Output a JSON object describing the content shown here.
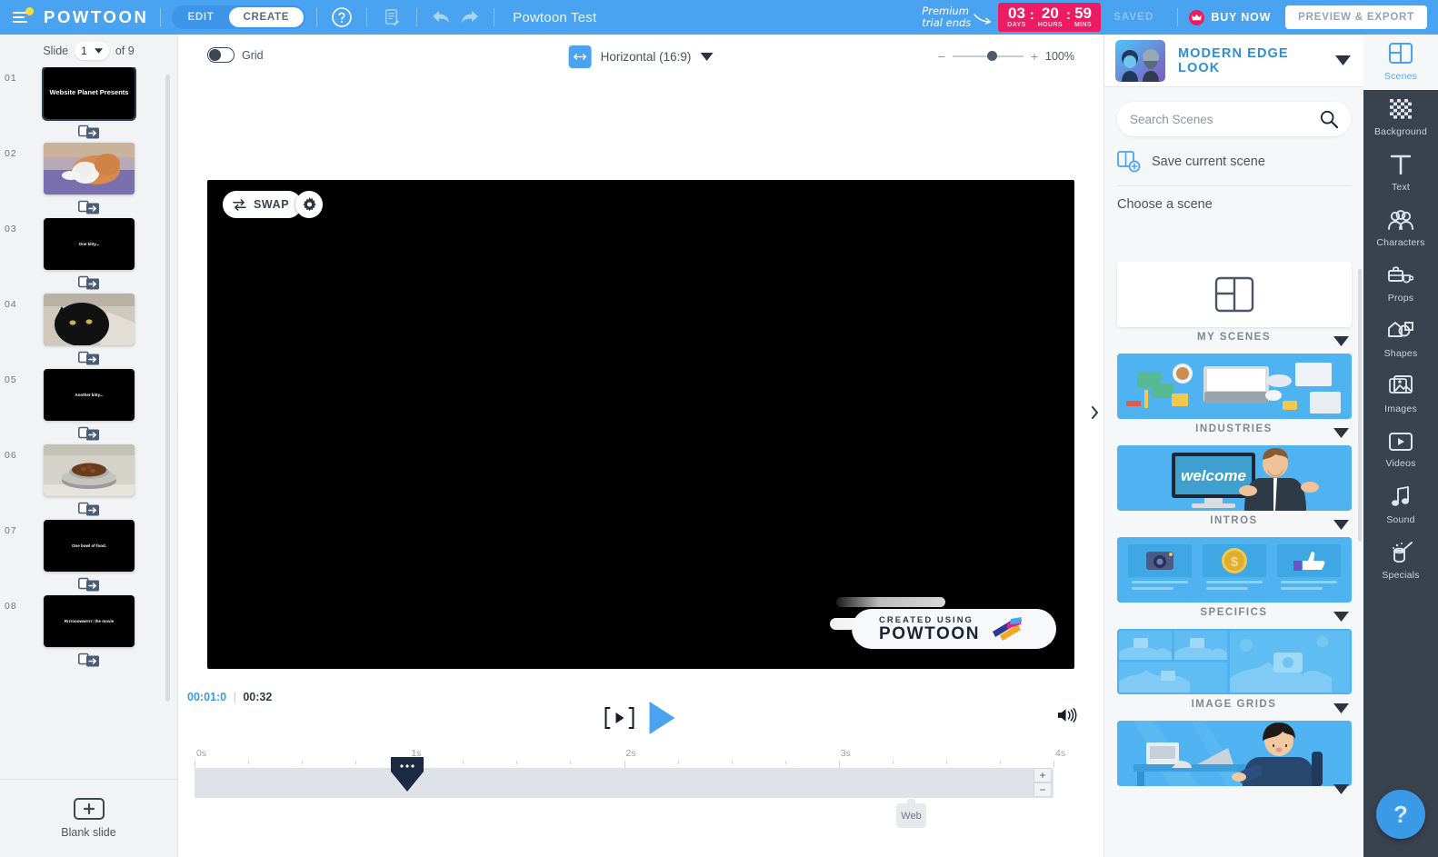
{
  "header": {
    "brand": "POWTOON",
    "modes": [
      {
        "label": "EDIT",
        "active": false
      },
      {
        "label": "CREATE",
        "active": true
      }
    ],
    "help_icon": "question-circle-icon",
    "notes_icon": "notes-edit-icon",
    "undo_icon": "undo-arrow-icon",
    "redo_icon": "redo-arrow-icon",
    "doc_title": "Powtoon Test",
    "promo_line1": "Premium",
    "promo_line2": "trial ends",
    "timer": {
      "days_value": "03",
      "days_label": "DAYS",
      "hours_value": "20",
      "hours_label": "HOURS",
      "mins_value": "59",
      "mins_label": "MINS",
      "separator": ":",
      "bg_color": "#ed1b61"
    },
    "saved_label": "SAVED",
    "buy_now_label": "BUY NOW",
    "crown_icon": "crown-icon",
    "preview_export_label": "PREVIEW & EXPORT",
    "bg_color": "#4aa3f0"
  },
  "slides": {
    "slide_word": "Slide",
    "current": "1",
    "of_label": "of 9",
    "total": 9,
    "items": [
      {
        "num": "01",
        "type": "text",
        "text": "Website Planet Presents",
        "font_size": "7.5px",
        "selected": true
      },
      {
        "num": "02",
        "type": "image",
        "subject": "orange-and-white-cat-in-cone-on-purple-blanket"
      },
      {
        "num": "03",
        "type": "text",
        "text": "One kitty...",
        "font_size": "4.5px",
        "selected": false
      },
      {
        "num": "04",
        "type": "image",
        "subject": "black-cat-on-tile-floor"
      },
      {
        "num": "05",
        "type": "text",
        "text": "Another kitty...",
        "font_size": "4.5px",
        "selected": false
      },
      {
        "num": "06",
        "type": "image",
        "subject": "metal-bowl-of-cat-food"
      },
      {
        "num": "07",
        "type": "text",
        "text": "One bowl of food.",
        "font_size": "4.5px",
        "selected": false
      },
      {
        "num": "08",
        "type": "text",
        "text": "Rrrrooowwrrrr: the movie",
        "font_size": "4.5px",
        "selected": false
      }
    ],
    "transition_icon": "slide-transition-icon",
    "blank_slide_label": "Blank slide",
    "add_icon": "plus-in-frame-icon",
    "collapse_icon": "chevron-left-icon"
  },
  "stage": {
    "grid_label": "Grid",
    "grid_on": false,
    "ratio_label": "Horizontal (16:9)",
    "ratio_icon": "horizontal-arrows-icon",
    "ratio_caret": "chevron-down-icon",
    "zoom_minus": "−",
    "zoom_plus": "+",
    "zoom_value": "100%",
    "swap_label": "SWAP",
    "swap_icon": "swap-arrows-icon",
    "settings_icon": "gear-icon",
    "watermark_small": "CREATED USING",
    "watermark_big": "POWTOON",
    "canvas_bg": "#000000",
    "collapse_icon": "chevron-right-icon"
  },
  "timeline": {
    "current_time": "00:01:0",
    "divider": "|",
    "total_time": "00:32",
    "step_icon": "step-frame-icon",
    "play_icon": "play-triangle-icon",
    "volume_icon": "speaker-waves-icon",
    "ruler_ticks": [
      "0s",
      "1s",
      "2s",
      "3s",
      "4s"
    ],
    "zoom_in_label": "+",
    "zoom_out_label": "−",
    "playhead_position_label": "1s",
    "web_tag": "Web"
  },
  "library": {
    "look_name": "MODERN EDGE LOOK",
    "look_caret": "chevron-down-icon",
    "search_placeholder": "Search Scenes",
    "search_value": "",
    "search_icon": "search-magnifier-icon",
    "save_scene_label": "Save current scene",
    "save_scene_icon": "save-scene-icon",
    "choose_label": "Choose a scene",
    "scene_caret": "caret-down-icon",
    "categories": [
      {
        "caption": "MY SCENES",
        "style": "placeholder",
        "icon": "layout-frame-icon"
      },
      {
        "caption": "INDUSTRIES",
        "style": "desk-flatlay"
      },
      {
        "caption": "INTROS",
        "style": "welcome-monitor",
        "screen_text": "welcome"
      },
      {
        "caption": "SPECIFICS",
        "style": "three-cards"
      },
      {
        "caption": "IMAGE GRIDS",
        "style": "grid-frames"
      },
      {
        "caption": "",
        "style": "office-woman-laptop"
      }
    ]
  },
  "tools": {
    "items": [
      {
        "label": "Scenes",
        "icon": "scenes-layout-icon",
        "active": true
      },
      {
        "label": "Background",
        "icon": "checkerboard-icon",
        "active": false
      },
      {
        "label": "Text",
        "icon": "text-T-icon",
        "active": false
      },
      {
        "label": "Characters",
        "icon": "people-group-icon",
        "active": false
      },
      {
        "label": "Props",
        "icon": "briefcase-cup-icon",
        "active": false
      },
      {
        "label": "Shapes",
        "icon": "shapes-icon",
        "active": false
      },
      {
        "label": "Images",
        "icon": "photos-stack-icon",
        "active": false
      },
      {
        "label": "Videos",
        "icon": "video-play-icon",
        "active": false
      },
      {
        "label": "Sound",
        "icon": "music-note-icon",
        "active": false
      },
      {
        "label": "Specials",
        "icon": "magic-hat-icon",
        "active": false
      }
    ],
    "bg_color": "#39424f",
    "help_label": "?"
  }
}
